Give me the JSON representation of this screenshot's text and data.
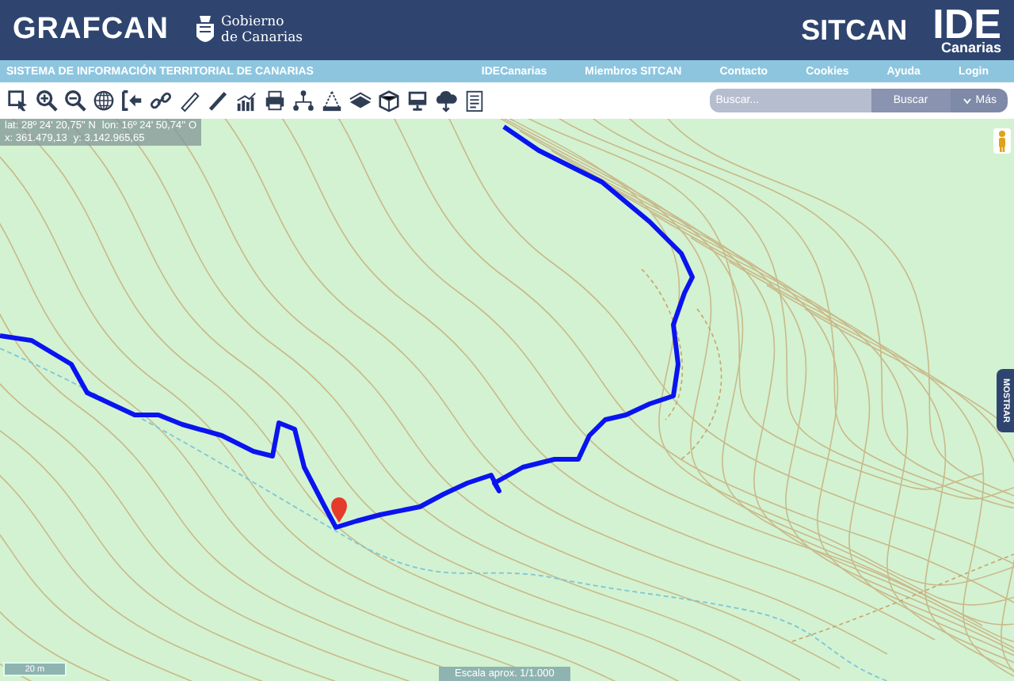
{
  "header": {
    "brand": "GRAFCAN",
    "government": [
      "Gobierno",
      "de Canarias"
    ],
    "sitcan": "SITCAN",
    "ide": "IDE",
    "ide_sub": "Canarias"
  },
  "nav": {
    "title": "SISTEMA DE INFORMACIÓN TERRITORIAL DE CANARIAS",
    "links": [
      "IDECanarias",
      "Miembros SITCAN",
      "Contacto",
      "Cookies",
      "Ayuda",
      "Login"
    ]
  },
  "search": {
    "placeholder": "Buscar...",
    "button": "Buscar",
    "more": "Más"
  },
  "map": {
    "coordinates": [
      [
        "lat: 28º 24' 20,75'' N",
        "lon: 16º 24' 50,74'' O"
      ],
      [
        "x: 361.479,13",
        "y: 3.142.965,65"
      ]
    ],
    "side_tab": "MOSTRAR",
    "scale_bar": "20 m",
    "scale_text": "Escala aprox. 1/1.000"
  }
}
